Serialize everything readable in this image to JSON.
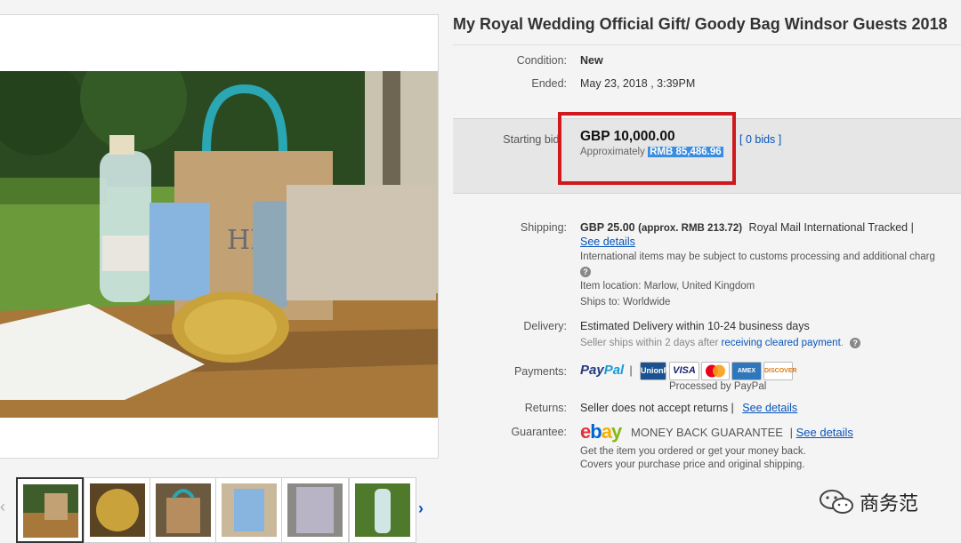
{
  "listing": {
    "title": "My Royal Wedding Official Gift/ Goody Bag Windsor Guests 2018"
  },
  "details": {
    "condition_label": "Condition:",
    "condition_value": "New",
    "ended_label": "Ended:",
    "ended_value": "May 23, 2018 , 3:39PM"
  },
  "bid": {
    "starting_bid_label": "Starting bid:",
    "price": "GBP 10,000.00",
    "approx_label": "Approximately",
    "approx_value": "RMB 85,486.96",
    "bids_link": "[ 0 bids ]",
    "highlight_color": "#d0191d"
  },
  "shipping": {
    "label": "Shipping:",
    "cost": "GBP 25.00",
    "approx": "(approx. RMB 213.72)",
    "service": "Royal Mail International Tracked |",
    "see_details": "See details",
    "customs_note": "International items may be subject to customs processing and additional charg",
    "item_location": "Item location:  Marlow, United Kingdom",
    "ships_to": "Ships to:  Worldwide"
  },
  "delivery": {
    "label": "Delivery:",
    "estimate": "Estimated Delivery within 10-24 business days",
    "handling_prefix": "Seller ships within 2 days after",
    "handling_link": "receiving cleared payment",
    "handling_suffix": "."
  },
  "payments": {
    "label": "Payments:",
    "paypal_1": "Pay",
    "paypal_2": "Pal",
    "separator": "|",
    "badges": [
      "UnionPay",
      "VISA",
      "MC",
      "AMEX",
      "DISCOVER"
    ],
    "processed_by": "Processed by PayPal"
  },
  "returns": {
    "label": "Returns:",
    "text": "Seller does not accept returns |",
    "see_details": "See details"
  },
  "guarantee": {
    "label": "Guarantee:",
    "ebay_letters": [
      "e",
      "b",
      "a",
      "y"
    ],
    "mbg": "MONEY BACK GUARANTEE",
    "separator": "|",
    "see_details": "See details",
    "line1": "Get the item you ordered or get your money back.",
    "line2": "Covers your purchase price and original shipping."
  },
  "gallery": {
    "prev_icon": "chevron-left-icon",
    "next_icon": "chevron-right-icon",
    "prev_glyph": "‹",
    "next_glyph": "›",
    "thumb_count": 6
  },
  "watermark": {
    "text": "商务范"
  },
  "colors": {
    "link": "#0654ba",
    "bid_box": "#e6e6e6",
    "approx_highlight": "#3b8de0"
  }
}
